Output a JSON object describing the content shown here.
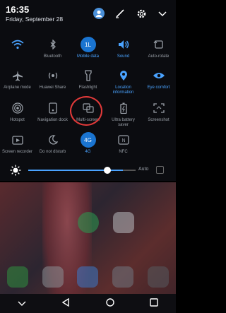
{
  "status": {
    "time": "16:35",
    "date": "Friday, September 28"
  },
  "top_icons": [
    "avatar-icon",
    "edit-icon",
    "settings-icon",
    "chevron-down-icon"
  ],
  "tiles": [
    {
      "label": "",
      "icon": "wifi-icon",
      "on": true
    },
    {
      "label": "Bluetooth",
      "icon": "bluetooth-icon",
      "on": false
    },
    {
      "label": "Mobile data",
      "icon": "mobile-data-icon",
      "on": true
    },
    {
      "label": "Sound",
      "icon": "sound-icon",
      "on": true
    },
    {
      "label": "Auto-rotate",
      "icon": "auto-rotate-icon",
      "on": false
    },
    {
      "label": "Airplane mode",
      "icon": "airplane-icon",
      "on": false
    },
    {
      "label": "Huawei Share",
      "icon": "share-icon",
      "on": false
    },
    {
      "label": "Flashlight",
      "icon": "flashlight-icon",
      "on": false
    },
    {
      "label": "Location information",
      "icon": "location-icon",
      "on": true
    },
    {
      "label": "Eye comfort",
      "icon": "eye-icon",
      "on": true
    },
    {
      "label": "Hotspot",
      "icon": "hotspot-icon",
      "on": false
    },
    {
      "label": "Navigation dock",
      "icon": "navigation-dock-icon",
      "on": false
    },
    {
      "label": "Multi-screen",
      "icon": "multi-screen-icon",
      "on": false
    },
    {
      "label": "Ultra battery saver",
      "icon": "battery-icon",
      "on": false
    },
    {
      "label": "Screenshot",
      "icon": "screenshot-icon",
      "on": false
    },
    {
      "label": "Screen recorder",
      "icon": "screen-recorder-icon",
      "on": false
    },
    {
      "label": "Do not disturb",
      "icon": "moon-icon",
      "on": false
    },
    {
      "label": "4G",
      "icon": "4g-icon",
      "on": true
    },
    {
      "label": "NFC",
      "icon": "nfc-icon",
      "on": false
    }
  ],
  "tile_badges": {
    "mobile_data": "1L",
    "four_g": "4G",
    "nfc": "N"
  },
  "brightness": {
    "level": 0.78,
    "auto_label": "Auto"
  },
  "colors": {
    "accent": "#1a74d0",
    "active_label": "#4aa3ff",
    "highlight": "#e23a3a"
  }
}
